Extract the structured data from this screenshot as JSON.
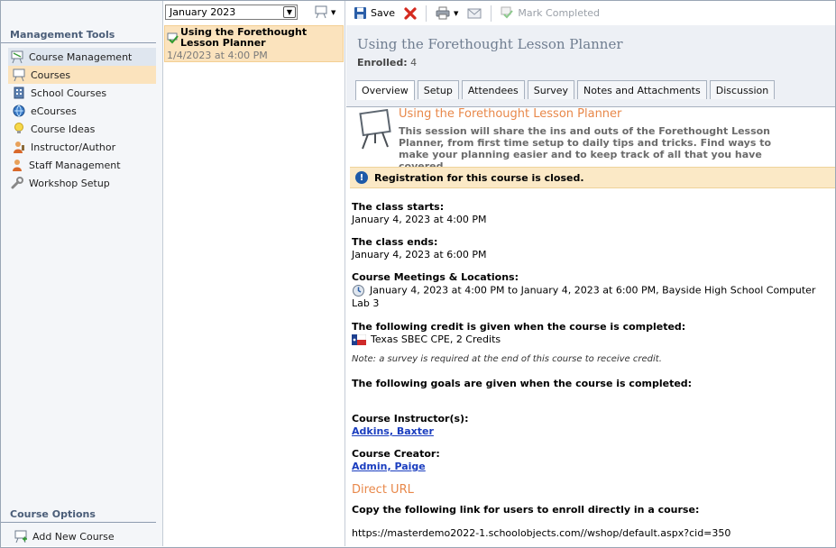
{
  "left_panel": {
    "management_title": "Management Tools",
    "items": [
      {
        "label": "Course Management",
        "icon": "course-management-icon"
      },
      {
        "label": "Courses",
        "icon": "courses-icon"
      },
      {
        "label": "School Courses",
        "icon": "school-courses-icon"
      },
      {
        "label": "eCourses",
        "icon": "ecourses-icon"
      },
      {
        "label": "Course Ideas",
        "icon": "course-ideas-icon"
      },
      {
        "label": "Instructor/Author",
        "icon": "instructor-author-icon"
      },
      {
        "label": "Staff Management",
        "icon": "staff-management-icon"
      },
      {
        "label": "Workshop Setup",
        "icon": "workshop-setup-icon"
      }
    ],
    "options_title": "Course Options",
    "add_new_course": "Add New Course"
  },
  "middle_panel": {
    "month_select": "January 2023",
    "course": {
      "title": "Using the Forethought Lesson Planner",
      "date": "1/4/2023 at 4:00 PM"
    }
  },
  "toolbar": {
    "save": "Save",
    "mark_completed": "Mark Completed"
  },
  "header": {
    "title": "Using the Forethought Lesson Planner",
    "enrolled_label": "Enrolled:",
    "enrolled_count": "4"
  },
  "tabs": [
    "Overview",
    "Setup",
    "Attendees",
    "Survey",
    "Notes and Attachments",
    "Discussion"
  ],
  "overview": {
    "title": "Using the Forethought Lesson Planner",
    "description": "This session will share the ins and outs of the Forethought Lesson Planner, from first time setup to daily tips and tricks. Find ways to make your planning easier and to keep track of all that you have covered.",
    "notice": "Registration for this course is closed.",
    "starts_label": "The class starts:",
    "starts_value": "January 4, 2023 at 4:00 PM",
    "ends_label": "The class ends:",
    "ends_value": "January 4, 2023 at 6:00 PM",
    "meetings_label": "Course Meetings & Locations:",
    "meetings_value": "January 4, 2023 at 4:00 PM to January 4, 2023 at 6:00 PM, Bayside High School Computer Lab 3",
    "credit_label": "The following credit is given when the course is completed:",
    "credit_value": "Texas SBEC CPE, 2 Credits",
    "survey_note": "Note: a survey is required at the end of this course to receive credit.",
    "goals_label": "The following goals are given when the course is completed:",
    "instructor_label": "Course Instructor(s):",
    "instructor_value": "Adkins, Baxter",
    "creator_label": "Course Creator:",
    "creator_value": "Admin, Paige",
    "direct_url_title": "Direct URL",
    "direct_url_label": "Copy the following link for users to enroll directly in a course:",
    "direct_url_value": "https://masterdemo2022-1.schoolobjects.com//wshop/default.aspx?cid=350"
  },
  "colors": {
    "accent_orange": "#e8884a",
    "selected_bg": "#fbe3bd",
    "link_blue": "#1a3dbf",
    "header_bg": "#edf0f5"
  }
}
